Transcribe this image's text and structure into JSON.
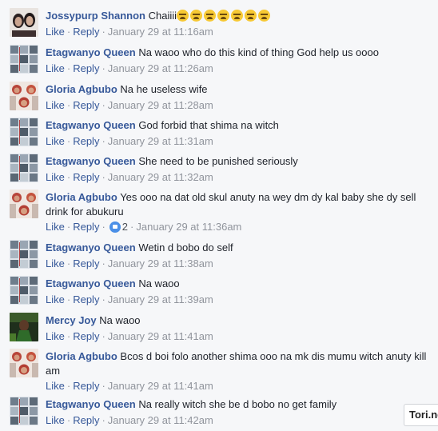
{
  "comments": [
    {
      "author": "Jossypurp Shannon",
      "text": "Chaiiii",
      "emoji_count": 7,
      "emoji_name": "loudly-crying-face-icon",
      "like": "Like",
      "reply": "Reply",
      "time": "January 29 at 11:16am",
      "avatar": "avatar-jossypurp"
    },
    {
      "author": "Etagwanyo Queen",
      "text": "Na waoo who do this kind of thing God help us oooo",
      "like": "Like",
      "reply": "Reply",
      "time": "January 29 at 11:26am",
      "avatar": "avatar-etagwanyo"
    },
    {
      "author": "Gloria Agbubo",
      "text": "Na he useless wife",
      "like": "Like",
      "reply": "Reply",
      "time": "January 29 at 11:28am",
      "avatar": "avatar-gloria"
    },
    {
      "author": "Etagwanyo Queen",
      "text": "God forbid that shima na witch",
      "like": "Like",
      "reply": "Reply",
      "time": "January 29 at 11:31am",
      "avatar": "avatar-etagwanyo"
    },
    {
      "author": "Etagwanyo Queen",
      "text": "She need to be punished seriously",
      "like": "Like",
      "reply": "Reply",
      "time": "January 29 at 11:32am",
      "avatar": "avatar-etagwanyo"
    },
    {
      "author": "Gloria Agbubo",
      "text": "Yes ooo na dat old skul anuty na wey dm dy kal baby she dy sell drink for abukuru",
      "like": "Like",
      "reply": "Reply",
      "reactions": "2",
      "time": "January 29 at 11:36am",
      "avatar": "avatar-gloria"
    },
    {
      "author": "Etagwanyo Queen",
      "text": "Wetin d bobo do self",
      "like": "Like",
      "reply": "Reply",
      "time": "January 29 at 11:38am",
      "avatar": "avatar-etagwanyo"
    },
    {
      "author": "Etagwanyo Queen",
      "text": "Na waoo",
      "like": "Like",
      "reply": "Reply",
      "time": "January 29 at 11:39am",
      "avatar": "avatar-etagwanyo"
    },
    {
      "author": "Mercy Joy",
      "text": "Na waoo",
      "like": "Like",
      "reply": "Reply",
      "time": "January 29 at 11:41am",
      "avatar": "avatar-mercy"
    },
    {
      "author": "Gloria Agbubo",
      "text": "Bcos d boi folo another shima ooo na mk dis mumu witch anuty kill am",
      "like": "Like",
      "reply": "Reply",
      "time": "January 29 at 11:41am",
      "avatar": "avatar-gloria"
    },
    {
      "author": "Etagwanyo Queen",
      "text": "Na really witch she be d bobo no get family",
      "like": "Like",
      "reply": "Reply",
      "time": "January 29 at 11:42am",
      "avatar": "avatar-etagwanyo"
    }
  ],
  "watermark": "Tori.ng",
  "colors": {
    "author": "#365899",
    "link": "#365899",
    "meta": "#90949c",
    "background": "#f6f7f9",
    "reaction": "#4a8fe7"
  }
}
